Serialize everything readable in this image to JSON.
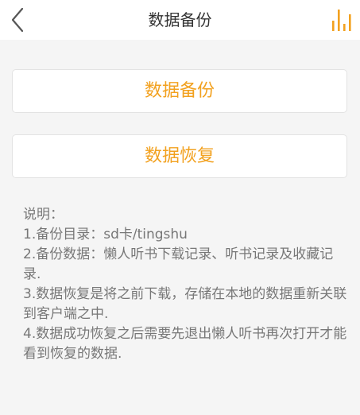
{
  "header": {
    "title": "数据备份"
  },
  "actions": {
    "backup_label": "数据备份",
    "restore_label": "数据恢复"
  },
  "notes": {
    "heading": "说明：",
    "lines": [
      "1.备份目录：sd卡/tingshu",
      "2.备份数据：懒人听书下载记录、听书记录及收藏记录.",
      "3.数据恢复是将之前下载，存储在本地的数据重新关联到客户端之中.",
      "4.数据成功恢复之后需要先退出懒人听书再次打开才能看到恢复的数据."
    ]
  },
  "icons": {
    "back": "chevron-left-icon",
    "menu": "equalizer-bars-icon"
  },
  "colors": {
    "accent": "#f2a11f",
    "title_text": "#333333",
    "note_text": "#777777",
    "background": "#f5f5f5"
  }
}
